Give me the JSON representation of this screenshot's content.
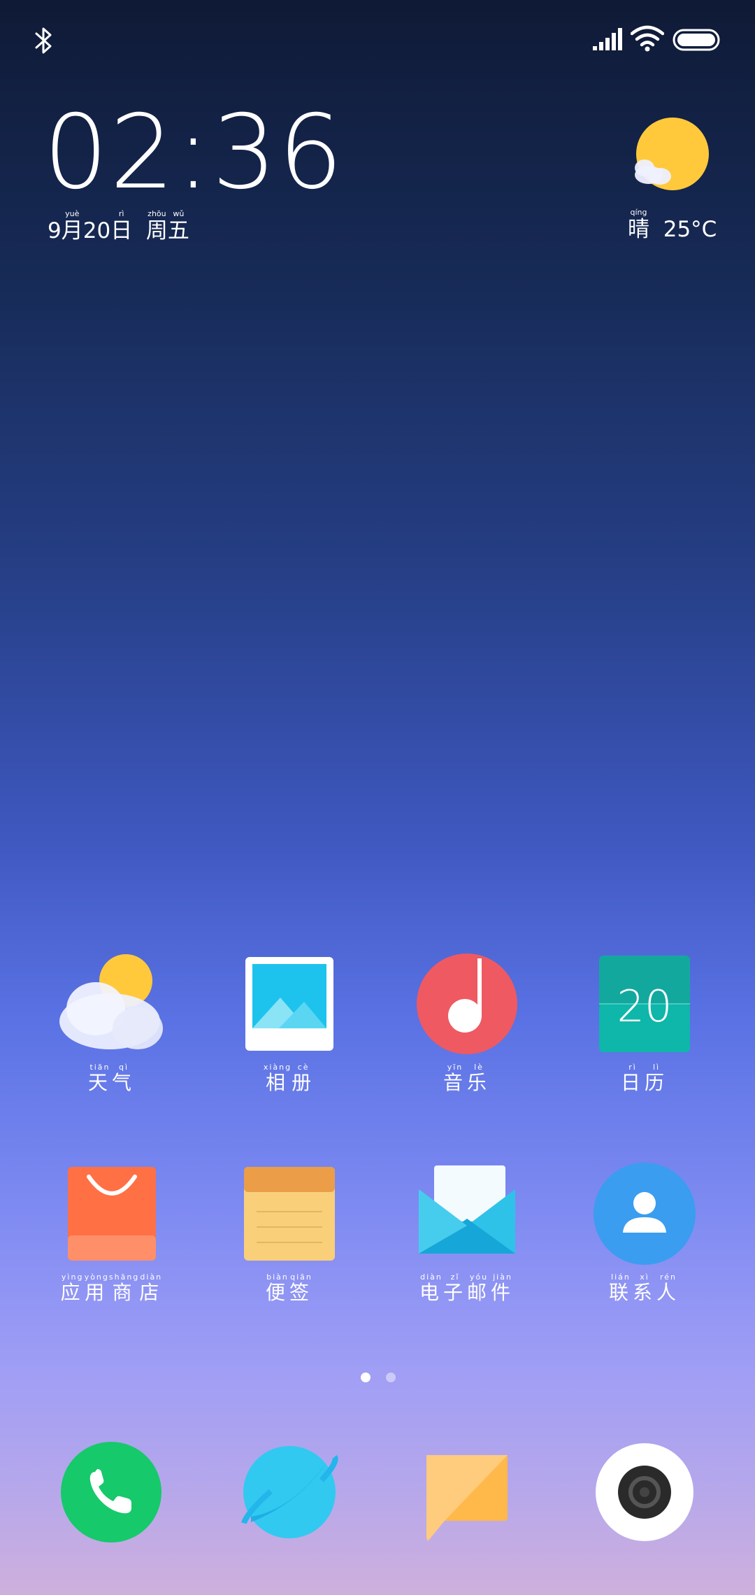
{
  "status_bar": {
    "icons": [
      "bluetooth-icon",
      "signal-icon",
      "wifi-icon",
      "battery-icon"
    ]
  },
  "clock": {
    "time": "02:36",
    "date": [
      {
        "char": "9",
        "pinyin": ""
      },
      {
        "char": "月",
        "pinyin": "yuè"
      },
      {
        "char": "20",
        "pinyin": ""
      },
      {
        "char": "日",
        "pinyin": "rì"
      },
      {
        "char": " ",
        "pinyin": ""
      },
      {
        "char": "周",
        "pinyin": "zhōu"
      },
      {
        "char": "五",
        "pinyin": "wǔ"
      }
    ]
  },
  "weather": {
    "condition": "晴",
    "condition_pinyin": "qíng",
    "temperature": "25°C",
    "icon": "sun-cloud-icon"
  },
  "apps": [
    {
      "id": "weather",
      "icon": "weather-app-icon",
      "label": [
        {
          "c": "天",
          "p": "tiān"
        },
        {
          "c": "气",
          "p": "qì"
        }
      ]
    },
    {
      "id": "gallery",
      "icon": "gallery-app-icon",
      "label": [
        {
          "c": "相",
          "p": "xiàng"
        },
        {
          "c": "册",
          "p": "cè"
        }
      ]
    },
    {
      "id": "music",
      "icon": "music-app-icon",
      "label": [
        {
          "c": "音",
          "p": "yīn"
        },
        {
          "c": "乐",
          "p": "lè"
        }
      ]
    },
    {
      "id": "calendar",
      "icon": "calendar-app-icon",
      "label": [
        {
          "c": "日",
          "p": "rì"
        },
        {
          "c": "历",
          "p": "lì"
        }
      ],
      "day": "20"
    },
    {
      "id": "app-store",
      "icon": "app-store-icon",
      "label": [
        {
          "c": "应",
          "p": "yìng"
        },
        {
          "c": "用",
          "p": "yòng"
        },
        {
          "c": "商",
          "p": "shāng"
        },
        {
          "c": "店",
          "p": "diàn"
        }
      ]
    },
    {
      "id": "notes",
      "icon": "notes-app-icon",
      "label": [
        {
          "c": "便",
          "p": "biàn"
        },
        {
          "c": "签",
          "p": "qiān"
        }
      ]
    },
    {
      "id": "email",
      "icon": "email-app-icon",
      "label": [
        {
          "c": "电",
          "p": "diàn"
        },
        {
          "c": "子",
          "p": "zǐ"
        },
        {
          "c": "邮",
          "p": "yóu"
        },
        {
          "c": "件",
          "p": "jiàn"
        }
      ]
    },
    {
      "id": "contacts",
      "icon": "contacts-app-icon",
      "label": [
        {
          "c": "联",
          "p": "lián"
        },
        {
          "c": "系",
          "p": "xì"
        },
        {
          "c": "人",
          "p": "rén"
        }
      ]
    }
  ],
  "page_indicator": {
    "pages": 2,
    "current": 1
  },
  "dock": [
    {
      "id": "phone",
      "icon": "phone-icon"
    },
    {
      "id": "browser",
      "icon": "browser-icon"
    },
    {
      "id": "messages",
      "icon": "messages-icon"
    },
    {
      "id": "camera",
      "icon": "camera-icon"
    }
  ],
  "colors": {
    "phone_green": "#16c96a",
    "browser_cyan": "#31c9f0",
    "music_red": "#ef5962",
    "calendar_teal": "#13a89e",
    "store_orange": "#ff7045",
    "notes_yellow": "#f9cf7a",
    "contacts_blue": "#3a9df0",
    "weather_sun": "#ffc93b"
  }
}
